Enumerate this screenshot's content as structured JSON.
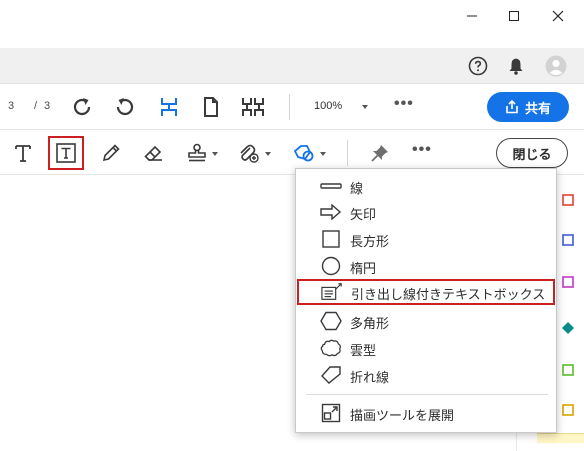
{
  "header": {
    "help_icon": "question-circle-icon",
    "notifications_icon": "bell-icon",
    "avatar_icon": "user-avatar-icon"
  },
  "toolbar": {
    "current_page": "3",
    "page_separator": "/",
    "total_pages": "3",
    "zoom": "100%",
    "more": "•••",
    "share_label": "共有",
    "share_color": "#1473e6"
  },
  "comment_toolbar": {
    "more": "•••",
    "close_label": "閉じる",
    "selected_outline_color": "#cc1f1f"
  },
  "shape_menu": {
    "items": [
      {
        "label": "線",
        "icon": "line-icon"
      },
      {
        "label": "矢印",
        "icon": "arrow-icon"
      },
      {
        "label": "長方形",
        "icon": "rectangle-icon"
      },
      {
        "label": "楕円",
        "icon": "ellipse-icon"
      },
      {
        "label": "引き出し線付きテキストボックス",
        "icon": "callout-textbox-icon",
        "highlighted": true
      },
      {
        "label": "多角形",
        "icon": "polygon-icon"
      },
      {
        "label": "雲型",
        "icon": "cloud-icon"
      },
      {
        "label": "折れ線",
        "icon": "polyline-icon"
      }
    ],
    "expand_label": "描画ツールを展開",
    "expand_icon": "expand-drawing-tools-icon"
  }
}
